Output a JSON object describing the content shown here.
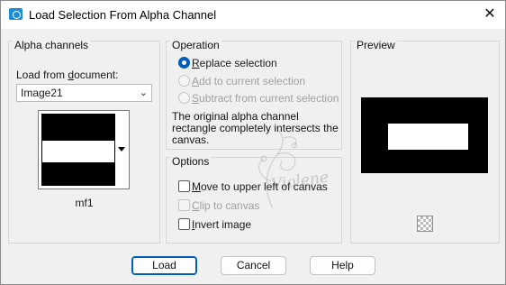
{
  "window": {
    "title": "Load Selection From Alpha Channel",
    "close_symbol": "✕",
    "app_icon": "camera-icon"
  },
  "alpha_channels": {
    "group_label": "Alpha channels",
    "load_from_label": "Load from document:",
    "document_value": "Image21",
    "channel_name": "mf1"
  },
  "operation": {
    "group_label": "Operation",
    "options": [
      {
        "label": "Replace selection",
        "checked": true,
        "enabled": true
      },
      {
        "label": "Add to current selection",
        "checked": false,
        "enabled": false
      },
      {
        "label": "Subtract from current selection",
        "checked": false,
        "enabled": false
      }
    ],
    "note": "The original alpha channel rectangle completely intersects the canvas."
  },
  "options": {
    "group_label": "Options",
    "items": [
      {
        "label": "Move to upper left of canvas",
        "checked": false,
        "enabled": true
      },
      {
        "label": "Clip to canvas",
        "checked": false,
        "enabled": false
      },
      {
        "label": "Invert image",
        "checked": false,
        "enabled": true
      }
    ]
  },
  "preview": {
    "group_label": "Preview",
    "toggle_icon": "checkerboard-icon"
  },
  "buttons": {
    "load": "Load",
    "cancel": "Cancel",
    "help": "Help"
  },
  "watermark": "Violene",
  "colors": {
    "accent": "#005fb8",
    "window_bg": "#f0f0f0",
    "disabled_text": "#a0a0a0"
  }
}
